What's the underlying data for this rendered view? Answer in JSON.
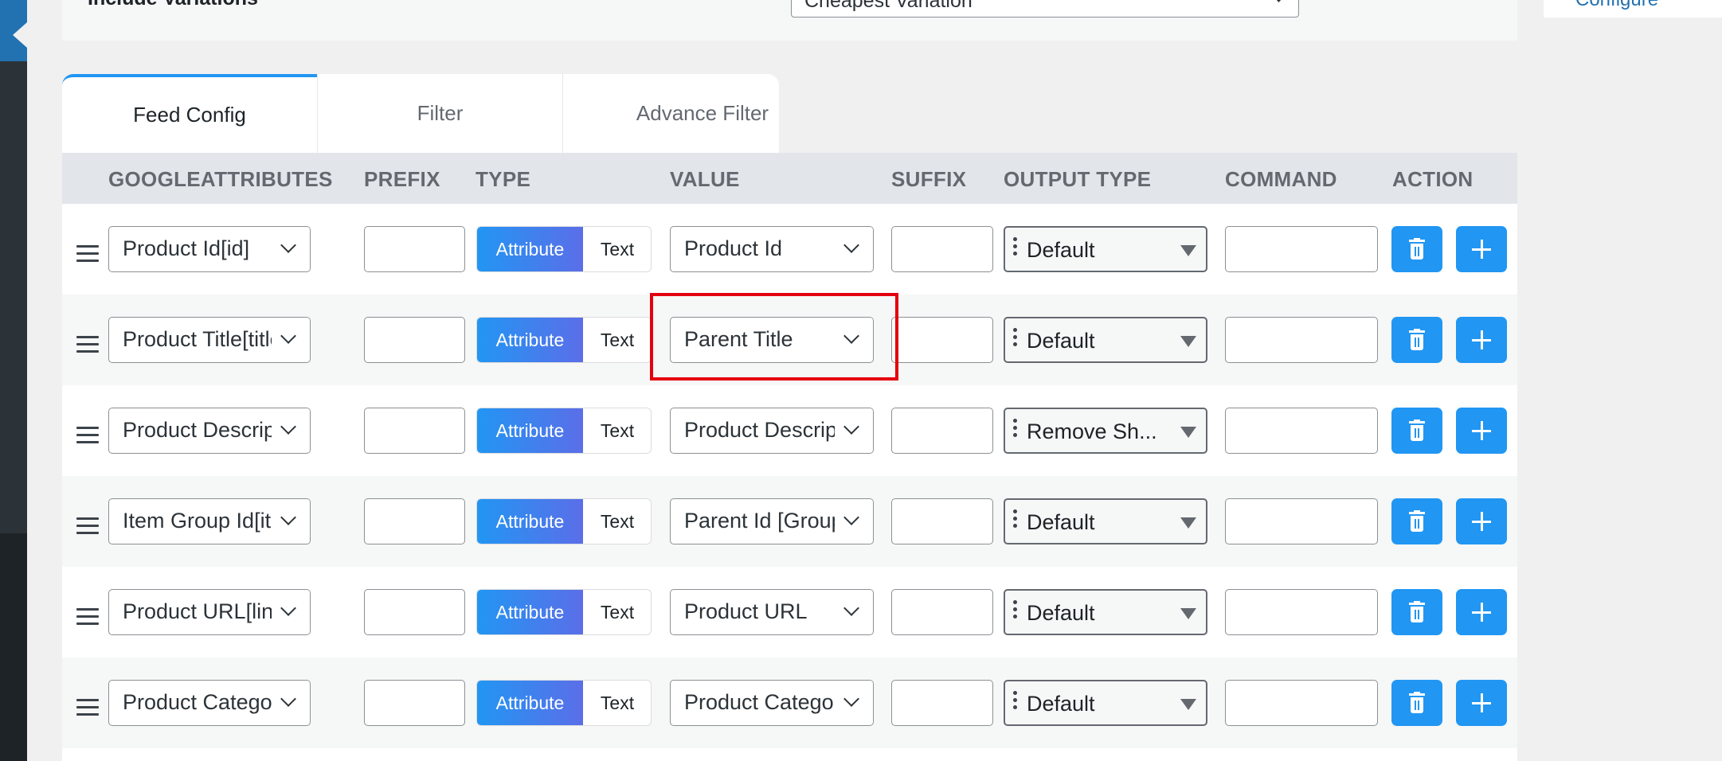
{
  "settings": {
    "variations_label": "Include Variations",
    "required_mark": "*",
    "variations_value": "Cheapest Variation"
  },
  "side_link": "Configure",
  "tabs": [
    {
      "label": "Feed Config",
      "active": true
    },
    {
      "label": "Filter",
      "active": false
    },
    {
      "label": "Advance Filter",
      "active": false
    }
  ],
  "columns": [
    "GOOGLEATTRIBUTES",
    "PREFIX",
    "TYPE",
    "VALUE",
    "SUFFIX",
    "OUTPUT TYPE",
    "COMMAND",
    "ACTION"
  ],
  "type_toggle": {
    "attribute": "Attribute",
    "text": "Text"
  },
  "rows": [
    {
      "attribute": "Product Id[id]",
      "prefix": "",
      "type": "Attribute",
      "value": "Product Id",
      "suffix": "",
      "output_type": "Default",
      "command": ""
    },
    {
      "attribute": "Product Title[title]",
      "prefix": "",
      "type": "Attribute",
      "value": "Parent Title",
      "suffix": "",
      "output_type": "Default",
      "command": ""
    },
    {
      "attribute": "Product Description[description]",
      "prefix": "",
      "type": "Attribute",
      "value": "Product Description",
      "suffix": "",
      "output_type": "Remove Sh...",
      "command": ""
    },
    {
      "attribute": "Item Group Id[item_group_id]",
      "prefix": "",
      "type": "Attribute",
      "value": "Parent Id [Group Id]",
      "suffix": "",
      "output_type": "Default",
      "command": ""
    },
    {
      "attribute": "Product URL[link]",
      "prefix": "",
      "type": "Attribute",
      "value": "Product URL",
      "suffix": "",
      "output_type": "Default",
      "command": ""
    },
    {
      "attribute": "Product Category[product_type]",
      "prefix": "",
      "type": "Attribute",
      "value": "Product Category",
      "suffix": "",
      "output_type": "Default",
      "command": ""
    }
  ],
  "colors": {
    "accent": "#2196f3",
    "highlight": "#e3000f",
    "header_bg": "#e2e5ea"
  }
}
